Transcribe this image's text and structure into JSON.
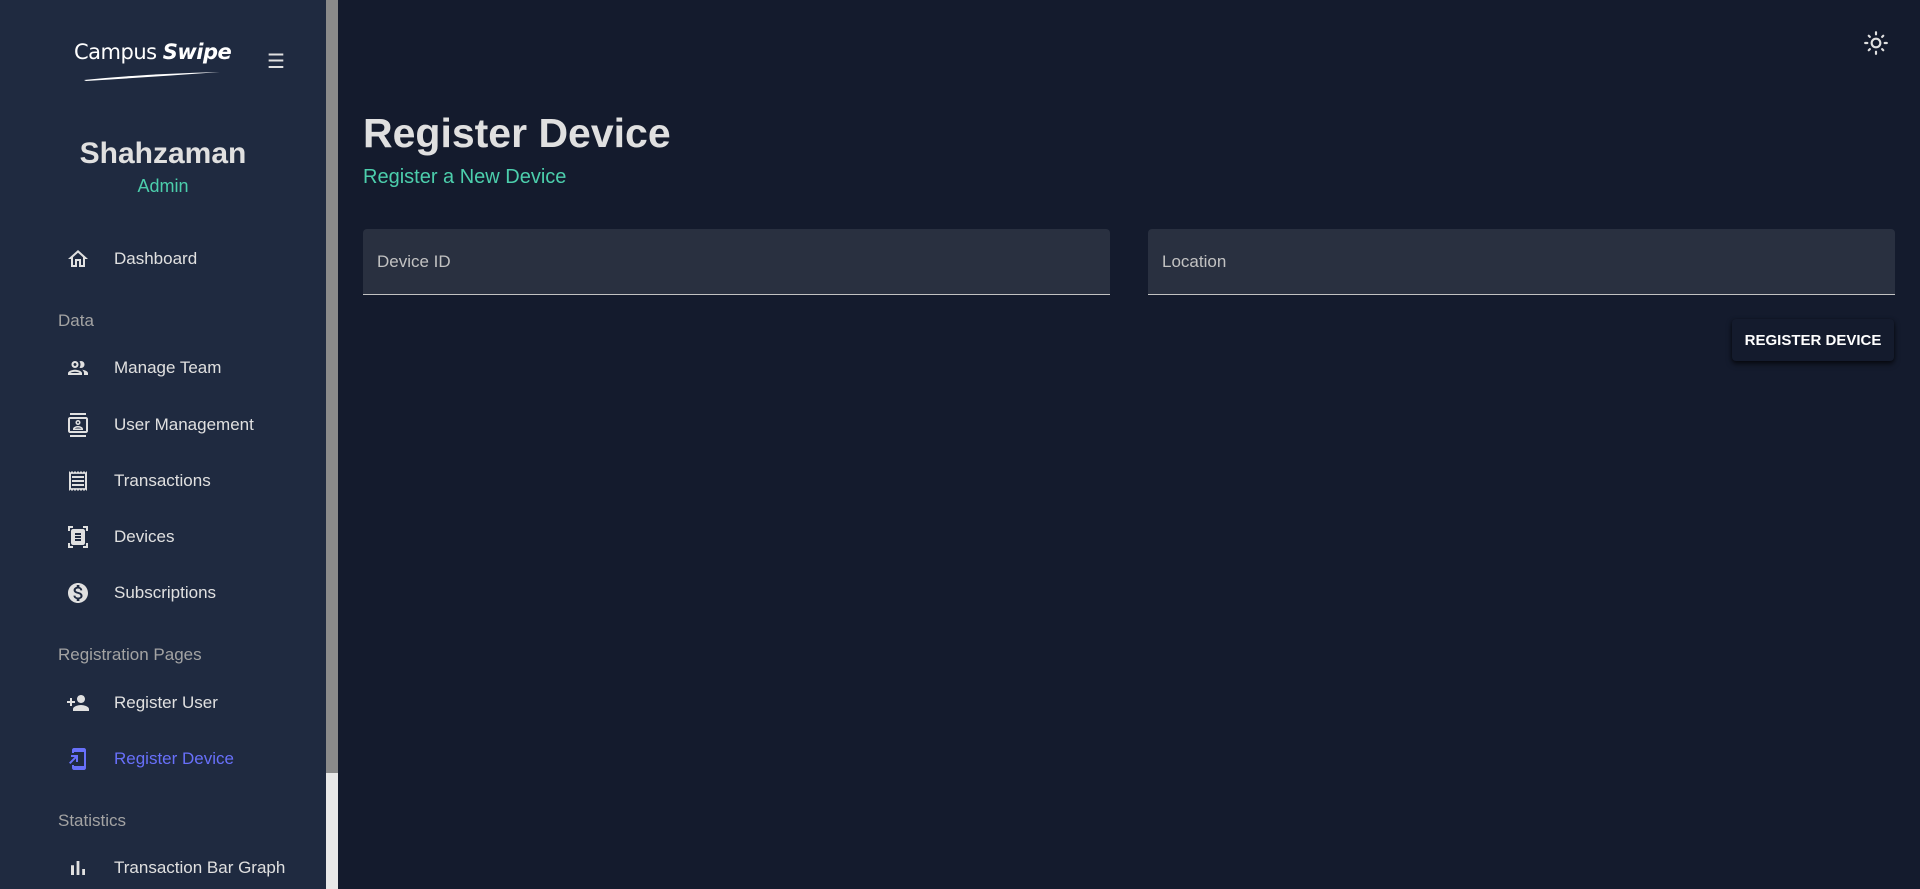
{
  "sidebar": {
    "logo": {
      "text_primary": "Campus",
      "text_accent": "Swipe"
    },
    "menu_icon": "hamburger-icon",
    "user": {
      "name": "Shahzaman",
      "role": "Admin"
    },
    "items": [
      {
        "label": "Dashboard",
        "icon": "home-icon"
      },
      {
        "label": "Manage Team",
        "icon": "people-icon"
      },
      {
        "label": "User Management",
        "icon": "contact-card-icon"
      },
      {
        "label": "Transactions",
        "icon": "receipt-icon"
      },
      {
        "label": "Devices",
        "icon": "document-scanner-icon"
      },
      {
        "label": "Subscriptions",
        "icon": "dollar-circle-icon"
      },
      {
        "label": "Register User",
        "icon": "person-add-icon"
      },
      {
        "label": "Register Device",
        "icon": "phonelink-icon",
        "active": true
      },
      {
        "label": "Transaction Bar Graph",
        "icon": "bar-chart-icon"
      }
    ],
    "sections": {
      "data": "Data",
      "registration": "Registration Pages",
      "statistics": "Statistics"
    }
  },
  "topbar": {
    "theme_icon": "light-mode-sun-icon"
  },
  "main": {
    "title": "Register Device",
    "subtitle": "Register a New Device",
    "form": {
      "device_id": {
        "placeholder": "Device ID",
        "value": ""
      },
      "location": {
        "placeholder": "Location",
        "value": ""
      },
      "submit_label": "Register Device"
    }
  },
  "colors": {
    "background": "#141b2d",
    "sidebar": "#1f2a40",
    "accent_green": "#4cceac",
    "active_blue": "#6870fa",
    "field_bg": "#293040"
  }
}
